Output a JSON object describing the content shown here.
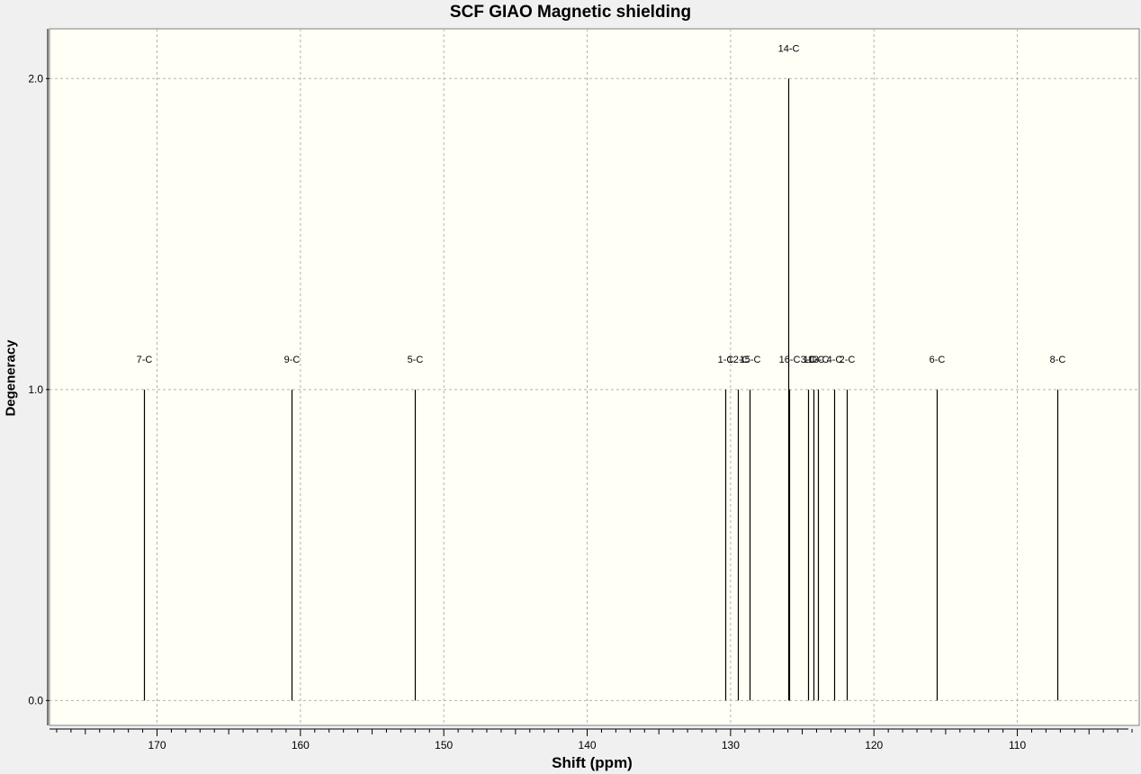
{
  "chart_data": {
    "type": "bar",
    "title": "SCF GIAO Magnetic shielding",
    "xlabel": "Shift (ppm)",
    "ylabel": "Degeneracy",
    "xlim": [
      177.5,
      101.5
    ],
    "x_reversed": true,
    "ylim": [
      -0.08,
      2.16
    ],
    "x_ticks": [
      170,
      160,
      150,
      140,
      130,
      120,
      110
    ],
    "y_ticks": [
      0.0,
      1.0,
      2.0
    ],
    "y_tick_labels": [
      "0.0",
      "1.0",
      "2.0"
    ],
    "grid": true,
    "peaks": [
      {
        "label": "7-C",
        "x": 170.9,
        "y": 1
      },
      {
        "label": "9-C",
        "x": 160.6,
        "y": 1
      },
      {
        "label": "5-C",
        "x": 152.0,
        "y": 1
      },
      {
        "label": "1-C",
        "x": 130.4,
        "y": 1
      },
      {
        "label": "12-C",
        "x": 129.5,
        "y": 1
      },
      {
        "label": "15-C",
        "x": 128.7,
        "y": 1
      },
      {
        "label": "14-C",
        "x": 126.0,
        "y": 2
      },
      {
        "label": "16-C",
        "x": 125.9,
        "y": 1
      },
      {
        "label": "3-C",
        "x": 124.6,
        "y": 1
      },
      {
        "label": "10-C",
        "x": 124.2,
        "y": 1
      },
      {
        "label": "13-C",
        "x": 123.9,
        "y": 1
      },
      {
        "label": "4-C",
        "x": 122.8,
        "y": 1
      },
      {
        "label": "2-C",
        "x": 121.9,
        "y": 1
      },
      {
        "label": "6-C",
        "x": 115.6,
        "y": 1
      },
      {
        "label": "8-C",
        "x": 107.2,
        "y": 1
      }
    ],
    "colors": {
      "plot_background": "#fffff5",
      "bar": "#000000",
      "grid": "#b4b4b4"
    }
  }
}
